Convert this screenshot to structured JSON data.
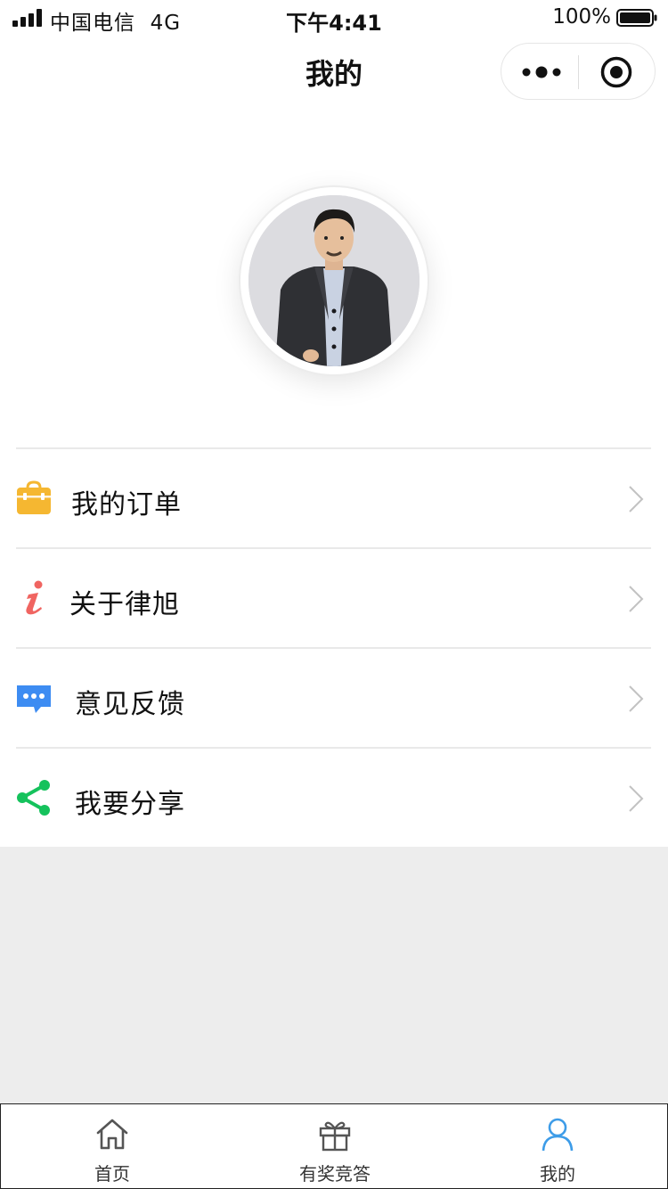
{
  "status_bar": {
    "carrier": "中国电信",
    "network": "4G",
    "time": "下午4:41",
    "battery": "100%"
  },
  "nav": {
    "title": "我的"
  },
  "menu": {
    "items": [
      {
        "label": "我的订单",
        "icon": "briefcase-icon",
        "color": "#f5b731"
      },
      {
        "label": "关于律旭",
        "icon": "info-icon",
        "color": "#f06561"
      },
      {
        "label": "意见反馈",
        "icon": "chat-bubble-icon",
        "color": "#3d8cf2"
      },
      {
        "label": "我要分享",
        "icon": "share-icon",
        "color": "#15c25c"
      }
    ]
  },
  "tabbar": {
    "tabs": [
      {
        "label": "首页",
        "icon": "home-icon"
      },
      {
        "label": "有奖竞答",
        "icon": "gift-icon"
      },
      {
        "label": "我的",
        "icon": "user-icon",
        "active": true,
        "active_color": "#3d9ce8"
      }
    ]
  }
}
